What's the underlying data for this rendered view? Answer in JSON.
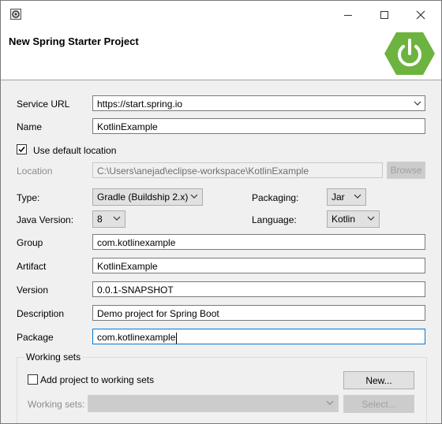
{
  "window": {
    "banner_title": "New Spring Starter Project"
  },
  "form": {
    "service_url": {
      "label": "Service URL",
      "value": "https://start.spring.io"
    },
    "name": {
      "label": "Name",
      "value": "KotlinExample"
    },
    "use_default_location": {
      "label": "Use default location",
      "checked": true
    },
    "location": {
      "label": "Location",
      "value": "C:\\Users\\anejad\\eclipse-workspace\\KotlinExample",
      "browse_label": "Browse"
    },
    "type": {
      "label": "Type:",
      "value": "Gradle (Buildship 2.x)"
    },
    "packaging": {
      "label": "Packaging:",
      "value": "Jar"
    },
    "java_version": {
      "label": "Java Version:",
      "value": "8"
    },
    "language": {
      "label": "Language:",
      "value": "Kotlin"
    },
    "group": {
      "label": "Group",
      "value": "com.kotlinexample"
    },
    "artifact": {
      "label": "Artifact",
      "value": "KotlinExample"
    },
    "version": {
      "label": "Version",
      "value": "0.0.1-SNAPSHOT"
    },
    "description": {
      "label": "Description",
      "value": "Demo project for Spring Boot"
    },
    "package": {
      "label": "Package",
      "value": "com.kotlinexample"
    }
  },
  "working_sets": {
    "title": "Working sets",
    "add_label": "Add project to working sets",
    "add_checked": false,
    "new_button": "New...",
    "working_sets_label": "Working sets:",
    "select_button": "Select..."
  },
  "colors": {
    "spring_green": "#6db33f",
    "focus_blue": "#0078d7"
  }
}
